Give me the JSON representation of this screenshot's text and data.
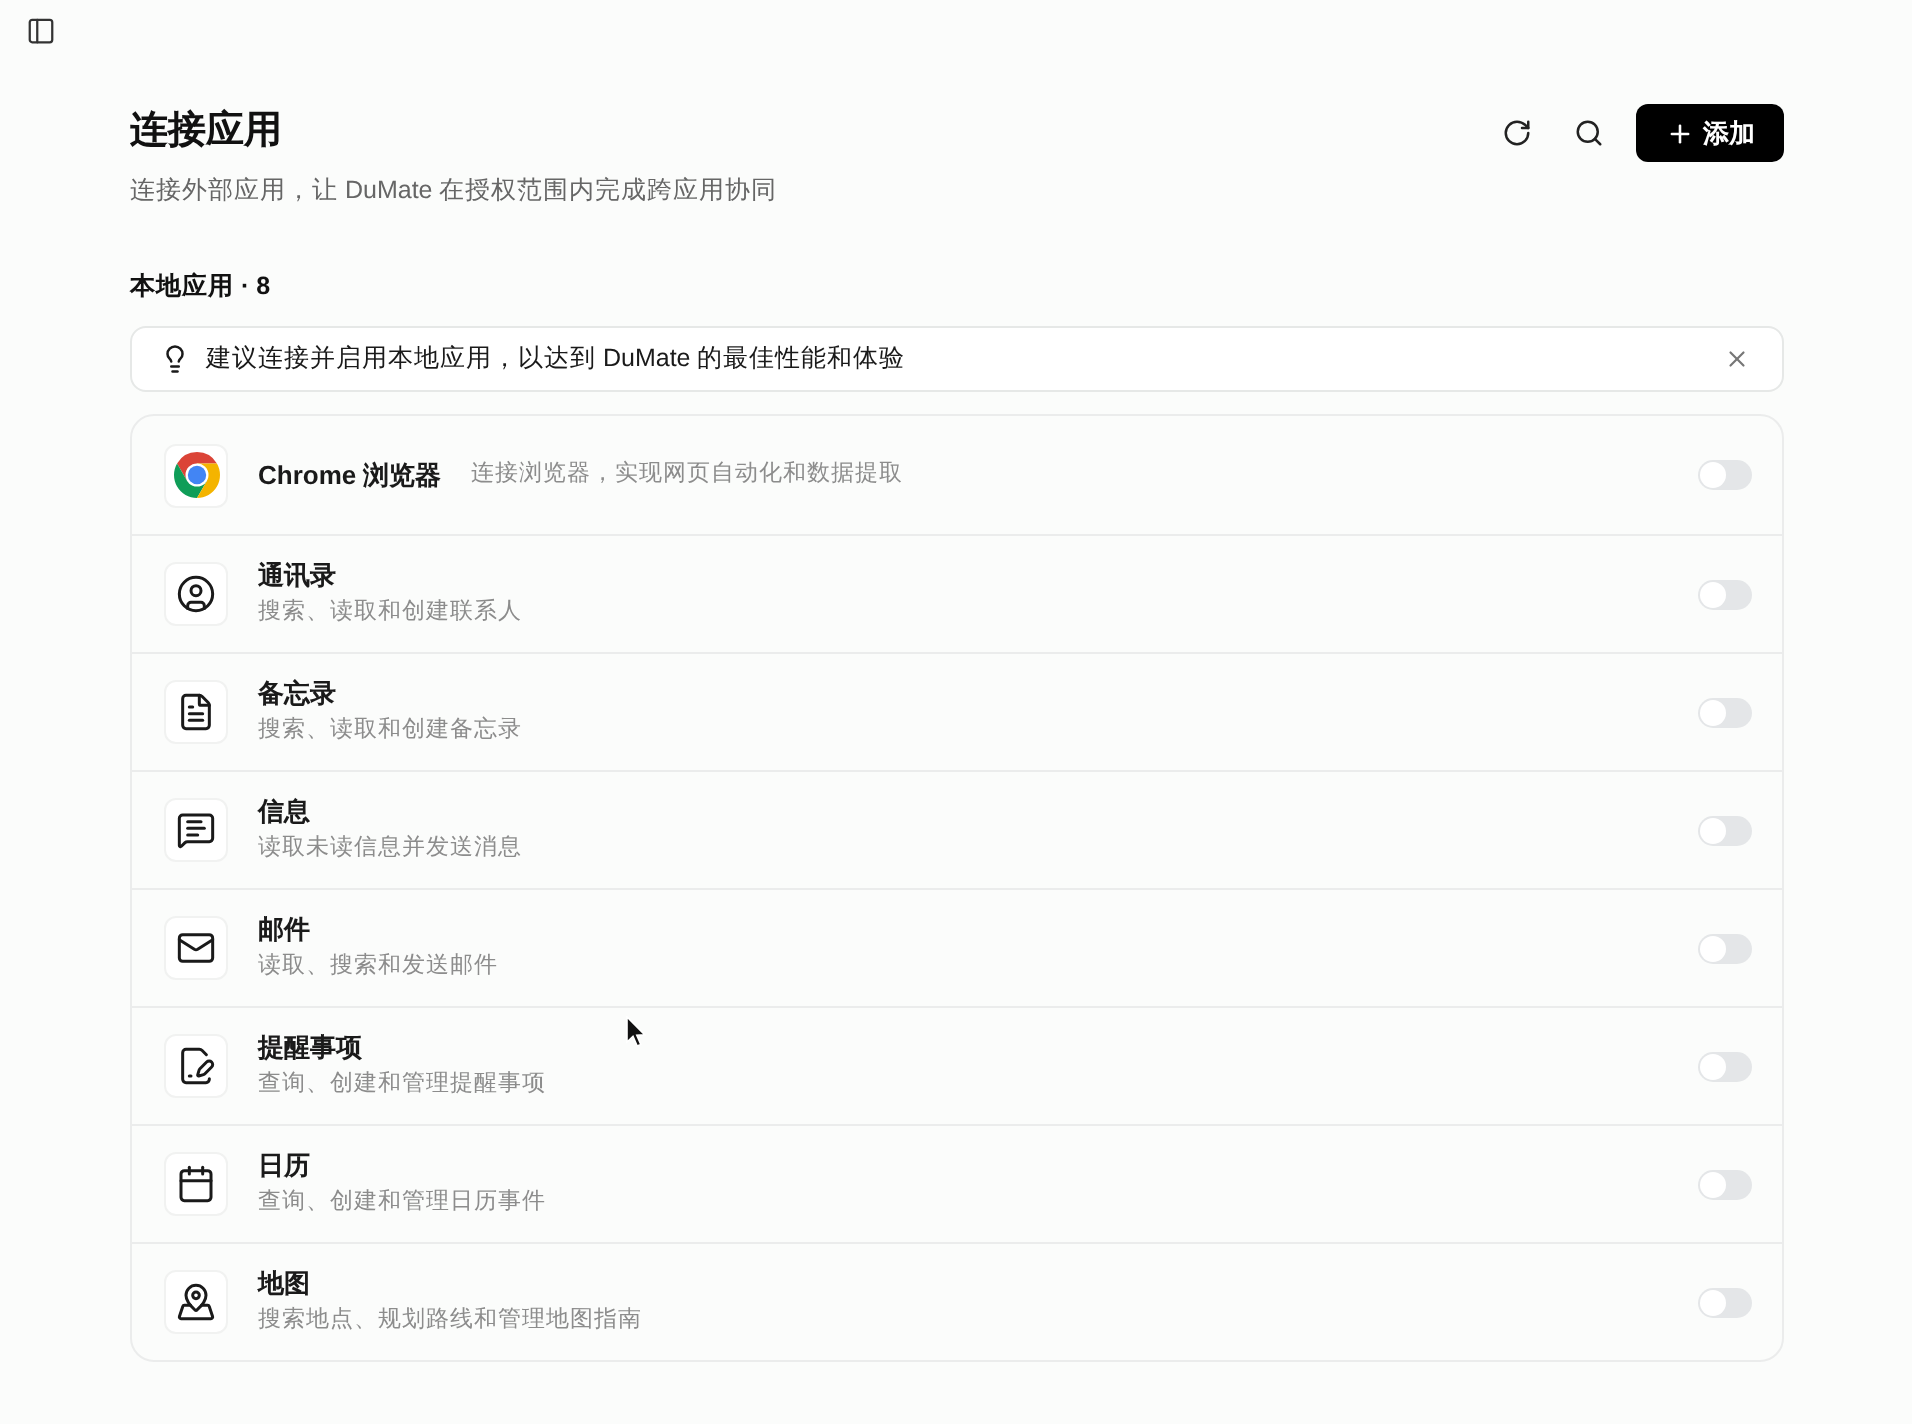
{
  "header": {
    "title": "连接应用",
    "subtitle": "连接外部应用，让 DuMate 在授权范围内完成跨应用协同",
    "add_button": "添加"
  },
  "section": {
    "label": "本地应用 · 8"
  },
  "banner": {
    "text": "建议连接并启用本地应用，以达到 DuMate 的最佳性能和体验"
  },
  "apps": [
    {
      "kind": "inline",
      "name": "Chrome 浏览器",
      "description": "连接浏览器，实现网页自动化和数据提取",
      "on": false
    },
    {
      "kind": "stacked",
      "name": "通讯录",
      "description": "搜索、读取和创建联系人",
      "on": false
    },
    {
      "kind": "stacked",
      "name": "备忘录",
      "description": "搜索、读取和创建备忘录",
      "on": false
    },
    {
      "kind": "stacked",
      "name": "信息",
      "description": "读取未读信息并发送消息",
      "on": false
    },
    {
      "kind": "stacked",
      "name": "邮件",
      "description": "读取、搜索和发送邮件",
      "on": false
    },
    {
      "kind": "stacked",
      "name": "提醒事项",
      "description": "查询、创建和管理提醒事项",
      "on": false
    },
    {
      "kind": "stacked",
      "name": "日历",
      "description": "查询、创建和管理日历事件",
      "on": false
    },
    {
      "kind": "stacked",
      "name": "地图",
      "description": "搜索地点、规划路线和管理地图指南",
      "on": false
    }
  ]
}
